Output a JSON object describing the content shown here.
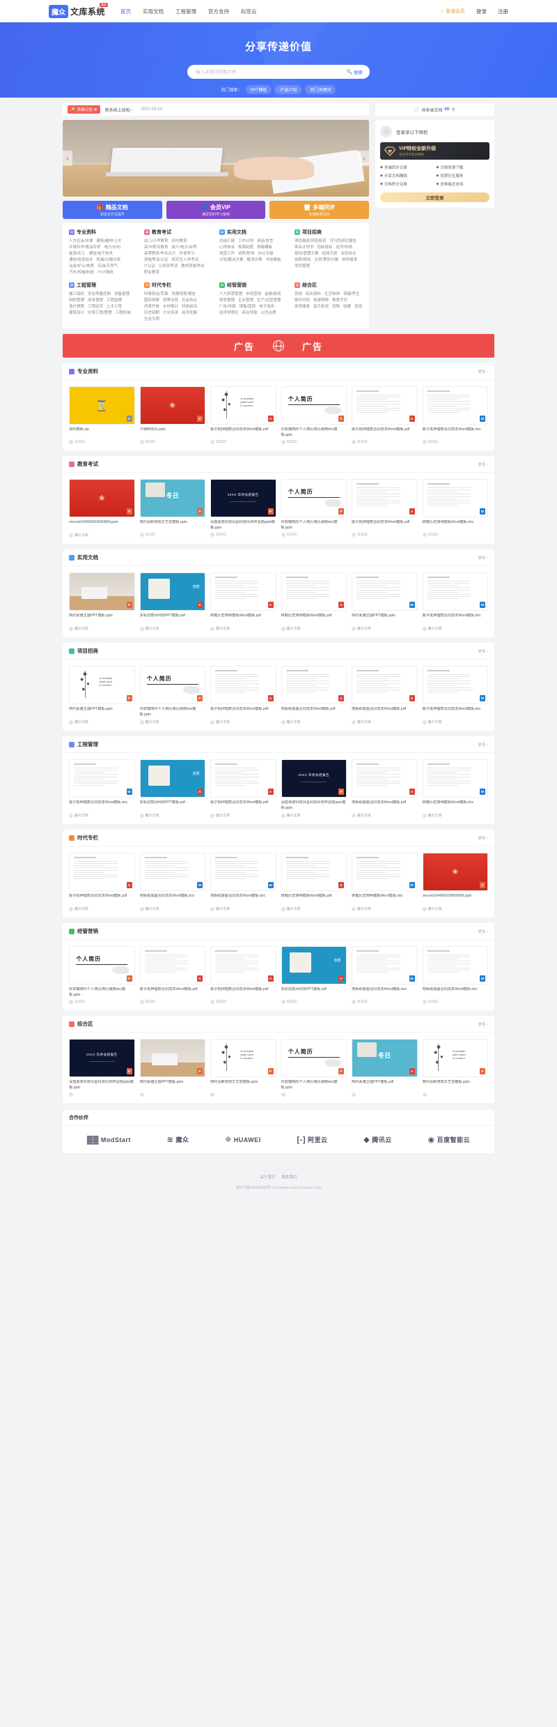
{
  "header": {
    "logo_mark": "魔众",
    "logo_text": "文库系统",
    "logo_badge": "最新",
    "nav": [
      {
        "label": "首页",
        "active": true
      },
      {
        "label": "实用文档",
        "active": false
      },
      {
        "label": "工程管理",
        "active": false
      },
      {
        "label": "官方支持",
        "active": false
      },
      {
        "label": "标签云",
        "active": false
      }
    ],
    "member_label": "普通会员",
    "member_icon": "crown-icon",
    "login_label": "登录",
    "register_label": "注册"
  },
  "hero": {
    "title": "分享传递价值",
    "search_placeholder": "输入关键词搜索文档",
    "search_value": "",
    "search_button": "搜索",
    "hot_label": "热门搜索：",
    "hot_tags": [
      "PPT模板",
      "产品介绍",
      "热门关键词"
    ]
  },
  "notice": {
    "badge": "系统公告",
    "text": "新系统上线啦~",
    "date": "2022-03-14"
  },
  "features": [
    {
      "title": "精品文档",
      "sub": "祝您全方位提升",
      "color": "#4a6ef0",
      "icon": "gift-icon"
    },
    {
      "title": "会员VIP",
      "sub": "满足您的学习使用",
      "color": "#8246c8",
      "icon": "user-icon"
    },
    {
      "title": "多端同步",
      "sub": "多端随意访问",
      "color": "#f0a33c",
      "icon": "monitor-icon"
    }
  ],
  "categories": [
    {
      "title": "专业资料",
      "color": "#8b6ef0",
      "links": [
        "人文社会/法律",
        "建筑/建材/土木",
        "环境科学/食品科学",
        "电力/水利",
        "能源/化工",
        "通信/电子技术",
        "通信/信息技术",
        "机械/仪器仪表",
        "冶金/矿山/地质",
        "石油/天然气",
        "汽车/机械/制造",
        "IT/计算机"
      ]
    },
    {
      "title": "教育考试",
      "color": "#e06fa0",
      "links": [
        "幼儿/小学教育",
        "初中教育",
        "高中/职业教育",
        "成人/电大/自考",
        "高等教育/毕业论文",
        "外语学习",
        "资格考试/认证",
        "研究生入学考试",
        "IT认证",
        "公务员考试",
        "教师资格考试",
        "职业教育"
      ]
    },
    {
      "title": "实用文档",
      "color": "#4a9ef0",
      "links": [
        "总结汇报",
        "工作计划",
        "讲话/发言",
        "心得体会",
        "规章制度",
        "表格模板",
        "党团工作",
        "求职/职场",
        "办公文秘",
        "计划/解决方案",
        "解决方案",
        "书信模板"
      ]
    },
    {
      "title": "项目招商",
      "color": "#3fc0a8",
      "links": [
        "项目融资/风险投资",
        "可行性研究报告",
        "商业计划书",
        "招标投标",
        "经济/市场",
        "规划/管理方案",
        "招商引资",
        "合同协议",
        "纳税/税收",
        "企划/策划方案",
        "财务报表",
        "项目管理"
      ]
    },
    {
      "title": "工程管理",
      "color": "#6b8df0",
      "links": [
        "施工组织",
        "安全质量控制",
        "设备管理",
        "材料管理",
        "成本管理",
        "工程监理",
        "造价预算",
        "工程经济",
        "土木工程",
        "建筑设计",
        "环境工程/管理",
        "工程机械"
      ]
    },
    {
      "title": "时代专栏",
      "color": "#f08a3c",
      "links": [
        "时事政治/军事",
        "发展规划/报告",
        "国际观察",
        "政策法规",
        "社会热点",
        "改革开放",
        "乡村振兴",
        "科技前沿",
        "历史回顾",
        "文化传承",
        "经济发展",
        "生态文明"
      ]
    },
    {
      "title": "经管营销",
      "color": "#3fbf6e",
      "links": [
        "人力资源管理",
        "市场营销",
        "金融/投资",
        "财务管理",
        "企业管理",
        "生产/运营管理",
        "广告/传媒",
        "销售/营销",
        "电子商务",
        "经济学理论",
        "商业贸易",
        "公司治理"
      ]
    },
    {
      "title": "综合区",
      "color": "#f06b6b",
      "links": [
        "其他",
        "综合资料",
        "生活休闲",
        "保健/养生",
        "娱乐时尚",
        "旅游购物",
        "美食烹饪",
        "体育健身",
        "音乐影视",
        "宠物",
        "收藏",
        "其他"
      ]
    }
  ],
  "sidebar": {
    "doc_count_label": "共收录文档",
    "doc_count_value": "68",
    "doc_count_unit": "个",
    "avatar_icon": "user-avatar-icon",
    "privilege_title": "登录享以下特权",
    "vip_title": "VIP特权全新升级",
    "vip_sub": "会员专享更多特权",
    "privileges": [
      "多端同步记录",
      "文档免费下载",
      "分享文档赚钱",
      "优质衍生服务",
      "文档积分兑换",
      "多种格式支持"
    ],
    "login_button": "立即登录"
  },
  "ad": {
    "left": "广告",
    "right": "广告",
    "icon": "globe-icon"
  },
  "more_label": "更多",
  "sections": [
    {
      "title": "专业资料",
      "color": "#8b6ef0",
      "items": [
        {
          "name": "资料模板.zip",
          "author": "111111",
          "ftype": "Z",
          "art": "yellow"
        },
        {
          "name": "卡通商务风.pptx",
          "author": "111111",
          "ftype": "P",
          "art": "red"
        },
        {
          "name": "房子抵押借款合同范本Word模板.pdf",
          "author": "111111",
          "ftype": "PDF",
          "art": "plant"
        },
        {
          "name": "红玫瑰简约个人简历简历通用doc模板.pptx",
          "author": "111111",
          "ftype": "P",
          "art": "resume"
        },
        {
          "name": "房子抵押借款合同范本Word模板.pdf",
          "author": "111111",
          "ftype": "PDF",
          "art": "lines"
        },
        {
          "name": "房子抵押借款合同范本Word模板.doc",
          "author": "111111",
          "ftype": "W",
          "art": "lines"
        }
      ]
    },
    {
      "title": "教育考试",
      "color": "#e06fa0",
      "items": [
        {
          "name": "vincent164660629650869.pptx",
          "author": "魔众文库",
          "ftype": "P",
          "art": "red"
        },
        {
          "name": "简约清新增效文艺范模板.pptx",
          "author": "111111",
          "ftype": "P",
          "art": "winter"
        },
        {
          "name": "深蓝渐变科技风星科技风年终总结pptx模板.pptx",
          "author": "111111",
          "ftype": "P",
          "art": "dark"
        },
        {
          "name": "红玫瑰简约个人简历简历通用doc模板.pptx",
          "author": "111111",
          "ftype": "P",
          "art": "resume"
        },
        {
          "name": "房子抵押借款合同范本Word模板.pdf",
          "author": "111111",
          "ftype": "PDF",
          "art": "lines"
        },
        {
          "name": "转载历史简明模板Word模板.doc",
          "author": "111111",
          "ftype": "W",
          "art": "lines"
        }
      ]
    },
    {
      "title": "实用文档",
      "color": "#4a9ef0",
      "items": [
        {
          "name": "简约素雅主题PPT模板.pptx",
          "author": "魔众文库",
          "ftype": "P",
          "art": "office"
        },
        {
          "name": "多彩创意风科技PPT模板.pdf",
          "author": "魔众文库",
          "ftype": "PDF",
          "art": "blue"
        },
        {
          "name": "转载历史简明模板Word模板.pdf",
          "author": "魔众文库",
          "ftype": "PDF",
          "art": "lines"
        },
        {
          "name": "转载历史简明模板Word模板.pdf",
          "author": "魔众文库",
          "ftype": "PDF",
          "art": "lines"
        },
        {
          "name": "简约素雅主题PPT模板.pptx",
          "author": "魔众文库",
          "ftype": "W",
          "art": "lines"
        },
        {
          "name": "房子抵押借款合同范本Word模板.doc",
          "author": "魔众文库",
          "ftype": "W",
          "art": "lines"
        }
      ]
    },
    {
      "title": "项目招商",
      "color": "#3fc0a8",
      "items": [
        {
          "name": "简约素雅主题PPT模板.pptx",
          "author": "魔众文库",
          "ftype": "P",
          "art": "plant"
        },
        {
          "name": "红玫瑰简约个人简历简历通用doc模板.pptx",
          "author": "魔众文库",
          "ftype": "P",
          "art": "resume"
        },
        {
          "name": "房子抵押借款合同范本Word模板.pdf",
          "author": "魔众文库",
          "ftype": "PDF",
          "art": "lines"
        },
        {
          "name": "地板纸房屋合同范本Word模板.pdf",
          "author": "魔众文库",
          "ftype": "PDF",
          "art": "lines"
        },
        {
          "name": "地板纸房屋合同范本Word模板.pdf",
          "author": "魔众文库",
          "ftype": "PDF",
          "art": "lines"
        },
        {
          "name": "房子抵押借款合同范本Word模板.doc",
          "author": "魔众文库",
          "ftype": "W",
          "art": "lines"
        }
      ]
    },
    {
      "title": "工程管理",
      "color": "#6b8df0",
      "items": [
        {
          "name": "房子抵押借款合同范本Word模板.doc",
          "author": "魔众文库",
          "ftype": "W",
          "art": "lines"
        },
        {
          "name": "多彩创意风科技PPT模板.pdf",
          "author": "魔众文库",
          "ftype": "PDF",
          "art": "blue"
        },
        {
          "name": "房子抵押借款合同范本Word模板.pdf",
          "author": "魔众文库",
          "ftype": "PDF",
          "art": "lines"
        },
        {
          "name": "深蓝渐变科技风星科技风年终总结pptx模板.pptx",
          "author": "魔众文库",
          "ftype": "P",
          "art": "dark"
        },
        {
          "name": "地板纸房屋合同范本Word模板.pdf",
          "author": "魔众文库",
          "ftype": "PDF",
          "art": "lines"
        },
        {
          "name": "转载历史简明模板Word模板.doc",
          "author": "魔众文库",
          "ftype": "W",
          "art": "lines"
        }
      ]
    },
    {
      "title": "时代专栏",
      "color": "#f08a3c",
      "items": [
        {
          "name": "房子抵押借款合同范本Word模板.pdf",
          "author": "魔众文库",
          "ftype": "PDF",
          "art": "lines"
        },
        {
          "name": "地板纸房屋合同范本Word模板.doc",
          "author": "魔众文库",
          "ftype": "W",
          "art": "lines"
        },
        {
          "name": "地板纸房屋合同范本Word模板.doc",
          "author": "魔众文库",
          "ftype": "W",
          "art": "lines"
        },
        {
          "name": "转载历史简明模板Word模板.pdf",
          "author": "魔众文库",
          "ftype": "PDF",
          "art": "lines"
        },
        {
          "name": "转载历史简明模板Word模板.doc",
          "author": "魔众文库",
          "ftype": "W",
          "art": "lines"
        },
        {
          "name": "vincent164660629650869.pptx",
          "author": "魔众文库",
          "ftype": "P",
          "art": "red"
        }
      ]
    },
    {
      "title": "经管营销",
      "color": "#3fbf6e",
      "items": [
        {
          "name": "红玫瑰简约个人简历简历通用doc模板.pptx",
          "author": "111111",
          "ftype": "P",
          "art": "resume"
        },
        {
          "name": "房子抵押借款合同范本Word模板.pdf",
          "author": "111111",
          "ftype": "PDF",
          "art": "lines"
        },
        {
          "name": "房子抵押借款合同范本Word模板.pdf",
          "author": "111111",
          "ftype": "PDF",
          "art": "lines"
        },
        {
          "name": "多彩创意风科技PPT模板.pdf",
          "author": "111111",
          "ftype": "PDF",
          "art": "blue"
        },
        {
          "name": "地板纸房屋合同范本Word模板.doc",
          "author": "111111",
          "ftype": "W",
          "art": "lines"
        },
        {
          "name": "地板纸房屋合同范本Word模板.doc",
          "author": "111111",
          "ftype": "W",
          "art": "lines"
        }
      ]
    },
    {
      "title": "综合区",
      "color": "#f06b6b",
      "items": [
        {
          "name": "深蓝渐变科技风星科技风年终总结pptx模板.pptx",
          "author": "",
          "ftype": "P",
          "art": "dark"
        },
        {
          "name": "简约素雅主题PPT模板.pptx",
          "author": "",
          "ftype": "P",
          "art": "office"
        },
        {
          "name": "简约清新增效文艺范模板.pptx",
          "author": "",
          "ftype": "P",
          "art": "plant"
        },
        {
          "name": "红玫瑰简约个人简历简历通用doc模板.pptx",
          "author": "",
          "ftype": "P",
          "art": "resume"
        },
        {
          "name": "简约素雅主题PPT模板.pdf",
          "author": "",
          "ftype": "PDF",
          "art": "winter"
        },
        {
          "name": "简约清新增效文艺范模板.pptx",
          "author": "",
          "ftype": "P",
          "art": "plant"
        }
      ]
    }
  ],
  "partners": {
    "title": "合作伙伴",
    "items": [
      {
        "mark": "▓▓",
        "name": "ModStart"
      },
      {
        "mark": "≋",
        "name": "魔众"
      },
      {
        "mark": "❈",
        "name": "HUAWEI"
      },
      {
        "mark": "[-]",
        "name": "阿里云"
      },
      {
        "mark": "◆",
        "name": "腾讯云"
      },
      {
        "mark": "◉",
        "name": "百度智能云"
      }
    ]
  },
  "footer": {
    "links": [
      "关于我们",
      "联系我们"
    ],
    "copyright": "鄂ICP备20000539号 ©mzwenku.demo.tecmz.com"
  }
}
